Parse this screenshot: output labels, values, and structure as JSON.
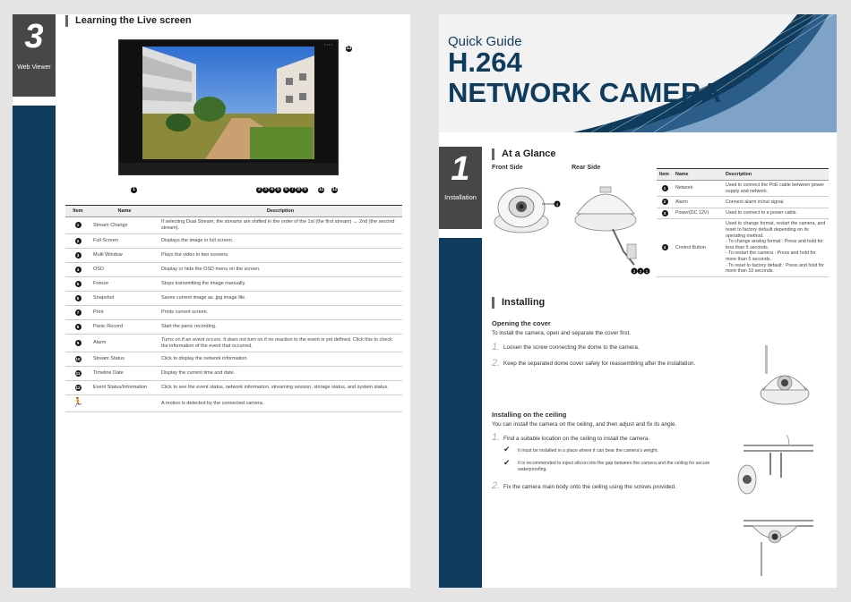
{
  "left": {
    "chapter_num": "3",
    "chapter_label": "Web Viewer",
    "section_title": "Learning the Live screen",
    "table_headers": [
      "Item",
      "Name",
      "Description"
    ],
    "rows": [
      {
        "item": "1",
        "name": "Stream Change",
        "desc": "If selecting Dual Stream, the streams are shifted in the order of the 1st (the first stream) ↔ 2nd (the second stream)."
      },
      {
        "item": "2",
        "name": "Full Screen",
        "desc": "Displays the image in full screen."
      },
      {
        "item": "3",
        "name": "Multi Window",
        "desc": "Plays the video in two screens."
      },
      {
        "item": "4",
        "name": "OSD",
        "desc": "Display or hide the OSD menu on the screen."
      },
      {
        "item": "5",
        "name": "Freeze",
        "desc": "Stops transmitting the image manually."
      },
      {
        "item": "6",
        "name": "Snapshot",
        "desc": "Saves current image as .jpg image file."
      },
      {
        "item": "7",
        "name": "Print",
        "desc": "Prints current screen."
      },
      {
        "item": "8",
        "name": "Panic Record",
        "desc": "Start the panic recording."
      },
      {
        "item": "9",
        "name": "Alarm",
        "desc": "Turns on if an event occurs. It does not turn on if no reaction to the event is yet defined. Click this to check the information of the event that occurred."
      },
      {
        "item": "10",
        "name": "Stream Status",
        "desc": "Click to display the network information."
      },
      {
        "item": "11",
        "name": "Timeline Date",
        "desc": "Display the current time and date."
      },
      {
        "item": "12",
        "name": "Event Status/Information",
        "desc": "Click to see the event status, network information, streaming session, storage status, and system status."
      },
      {
        "item": "13",
        "name": "",
        "desc": "A motion is detected by the connected camera."
      }
    ]
  },
  "right": {
    "quick_guide": "Quick Guide",
    "model": "H.264",
    "product": "NETWORK CAMERA",
    "chapter_num": "1",
    "chapter_label": "Installation",
    "glance_title": "At a Glance",
    "front_label": "Front Side",
    "rear_label": "Rear Side",
    "glance_headers": [
      "Item",
      "Name",
      "Description"
    ],
    "glance_rows": [
      {
        "item": "1",
        "name": "Network",
        "desc": "Used to connect the PoE cable between power supply and network."
      },
      {
        "item": "2",
        "name": "Alarm",
        "desc": "Connect alarm in/out signal."
      },
      {
        "item": "3",
        "name": "Power(DC 12V)",
        "desc": "Used to connect to a power cable."
      },
      {
        "item": "4",
        "name": "Control Button",
        "desc": "Used to change format, restart the camera, and reset to factory default depending on its operating method.\n- To change analog format : Press and hold for less than 5 seconds.\n- To restart the camera : Press and hold for more than 5 seconds.\n- To reset to factory default : Press and hold for more than 10 seconds."
      }
    ],
    "installing_title": "Installing",
    "cover_heading": "Opening the cover",
    "cover_intro": "To install the camera, open and separate the cover first.",
    "cover_steps": [
      "Loosen the screw connecting the dome to the camera.",
      "Keep the separated dome cover safely for reassembling after the installation."
    ],
    "ceiling_heading": "Installing on the ceiling",
    "ceiling_intro": "You can install the camera on the ceiling, and then adjust and fix its angle.",
    "ceiling_step1": "Find a suitable location on the ceiling to install the camera.",
    "ceiling_checks": [
      "It must be installed in a place where it can bear the camera's weight.",
      "It is recommended to inject silicon into the gap between the camera and the ceiling for secure waterproofing."
    ],
    "ceiling_step2": "Fix the camera main body onto the ceiling using the screws provided.",
    "step_nums": [
      "1.",
      "2."
    ]
  },
  "colors": {
    "navy": "#0f3b5c",
    "dark_gray": "#474747"
  },
  "icons": [
    "camera-dome-front-icon",
    "camera-dome-rear-icon",
    "runner-motion-icon",
    "check-icon"
  ]
}
